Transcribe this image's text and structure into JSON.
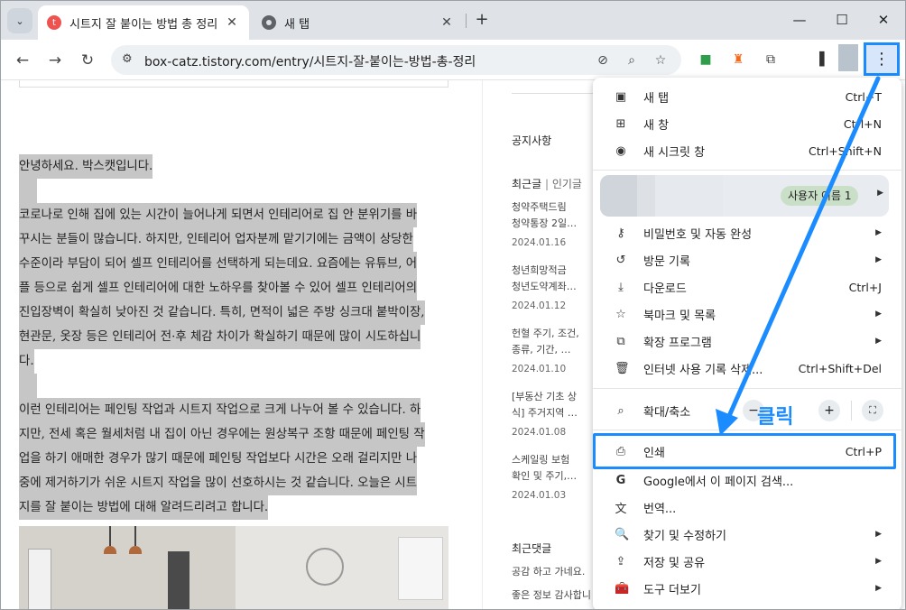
{
  "browser": {
    "tabs": [
      {
        "title": "시트지 잘 붙이는 방법 총 정리",
        "favicon": "tistory-icon",
        "active": true
      },
      {
        "title": "새 탭",
        "favicon": "chrome-icon",
        "active": false
      }
    ],
    "url": "box-catz.tistory.com/entry/시트지-잘-붙이는-방법-총-정리"
  },
  "article": {
    "lines": [
      "안녕하세요. 박스캣입니다.",
      "",
      "코로나로 인해 집에 있는 시간이 늘어나게 되면서 인테리어로 집 안 분위기를 바",
      "꾸시는 분들이 많습니다. 하지만, 인테리어 업자분께 맡기기에는 금액이 상당한",
      "수준이라 부담이 되어 셀프 인테리어를 선택하게 되는데요. 요즘에는 유튜브, 어",
      "플 등으로 쉽게 셀프 인테리어에 대한 노하우를 찾아볼 수 있어 셀프 인테리어의",
      "진입장벽이 확실히 낮아진 것 같습니다. 특히, 면적이 넓은 주방 싱크대 붙박이장,",
      "현관문, 옷장 등은 인테리어 전·후 체감 차이가 확실하기 때문에 많이 시도하십니",
      "다.",
      "",
      "이런 인테리어는 페인팅 작업과 시트지 작업으로 크게 나누어 볼 수 있습니다. 하",
      "지만, 전세 혹은 월세처럼 내 집이 아닌 경우에는 원상복구 조항 때문에 페인팅 작",
      "업을 하기 애매한 경우가 많기 때문에 페인팅 작업보다 시간은 오래 걸리지만 나",
      "중에 제거하기가 쉬운 시트지 작업을 많이 선호하시는 것 같습니다. 오늘은 시트",
      "지를 잘 붙이는 방법에 대해 알려드리려고 합니다."
    ]
  },
  "sidebar": {
    "notice_heading": "공지사항",
    "recent_tab": "최근글",
    "popular_tab": "인기글",
    "posts": [
      {
        "line1": "청약주택드림",
        "line2": "청약통장 2일…",
        "date": "2024.01.16"
      },
      {
        "line1": "청년희망적금",
        "line2": "청년도약계좌…",
        "date": "2024.01.12"
      },
      {
        "line1": "헌혈 주기, 조건,",
        "line2": "종류, 기간, …",
        "date": "2024.01.10"
      },
      {
        "line1": "[부동산 기초 상",
        "line2": "식] 주거지역 …",
        "date": "2024.01.08"
      },
      {
        "line1": "스케일링 보험",
        "line2": "확인 및 주기,…",
        "date": "2024.01.03"
      }
    ],
    "comments_heading": "최근댓글",
    "comments": [
      "공감 하고 가네요.",
      "좋은 정보 감사합니"
    ]
  },
  "menu": {
    "items_top": [
      {
        "label": "새 탭",
        "shortcut": "Ctrl+T",
        "icon": "new-tab-icon"
      },
      {
        "label": "새 창",
        "shortcut": "Ctrl+N",
        "icon": "new-window-icon"
      },
      {
        "label": "새 시크릿 창",
        "shortcut": "Ctrl+Shift+N",
        "icon": "incognito-icon"
      }
    ],
    "profile_chip": "사용자 이름 1",
    "items_mid": [
      {
        "label": "비밀번호 및 자동 완성",
        "icon": "key-icon",
        "submenu": true
      },
      {
        "label": "방문 기록",
        "icon": "history-icon",
        "submenu": true
      },
      {
        "label": "다운로드",
        "shortcut": "Ctrl+J",
        "icon": "download-icon"
      },
      {
        "label": "북마크 및 목록",
        "icon": "star-icon",
        "submenu": true
      },
      {
        "label": "확장 프로그램",
        "icon": "puzzle-icon",
        "submenu": true
      },
      {
        "label": "인터넷 사용 기록 삭제...",
        "shortcut": "Ctrl+Shift+Del",
        "icon": "trash-icon"
      }
    ],
    "zoom_label": "확대/축소",
    "print": {
      "label": "인쇄",
      "shortcut": "Ctrl+P"
    },
    "items_bottom": [
      {
        "label": "Google에서 이 페이지 검색...",
        "icon": "google-icon",
        "submenu": false
      },
      {
        "label": "번역...",
        "icon": "translate-icon",
        "submenu": false
      },
      {
        "label": "찾기 및 수정하기",
        "icon": "find-icon",
        "submenu": true
      },
      {
        "label": "저장 및 공유",
        "icon": "save-share-icon",
        "submenu": true
      },
      {
        "label": "도구 더보기",
        "icon": "toolbox-icon",
        "submenu": true
      }
    ]
  },
  "annotation": {
    "text": "클릭",
    "color": "#1a8cff"
  }
}
